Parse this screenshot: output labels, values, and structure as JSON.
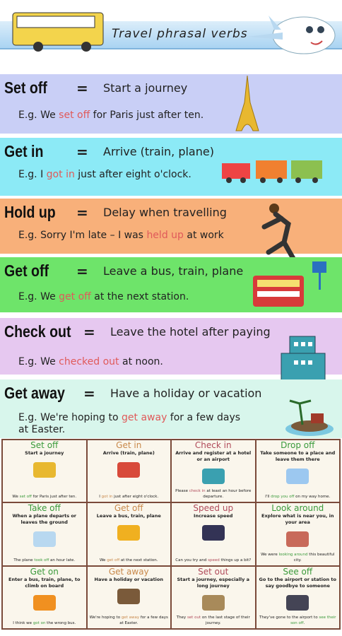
{
  "header": {
    "title": "Travel phrasal verbs"
  },
  "colors": {
    "highlight": "#e05a5a",
    "border": "#7a4a3a"
  },
  "bands": [
    {
      "verb": "Set off",
      "eq": "=",
      "def": "Start a journey",
      "ex": [
        "E.g. We ",
        "set off",
        " for Paris just after ten."
      ],
      "bg": "#c9cff6",
      "icon": "eiffel-tower-icon"
    },
    {
      "verb": "Get in",
      "eq": "=",
      "def": "Arrive (train, plane)",
      "ex": [
        "E.g. I ",
        "got in",
        " just after eight o'clock."
      ],
      "bg": "#8ceaf6",
      "icon": "train-icon"
    },
    {
      "verb": "Hold up",
      "eq": "=",
      "def": "Delay when travelling",
      "ex": [
        "E.g. Sorry I'm late – I was ",
        "held up",
        " at work"
      ],
      "bg": "#f8b07a",
      "icon": "running-man-icon"
    },
    {
      "verb": "Get off",
      "eq": "=",
      "def": "Leave a bus, train, plane",
      "ex": [
        "E.g. We ",
        "get off",
        " at the next station."
      ],
      "bg": "#6ee46a",
      "icon": "double-decker-bus-icon"
    },
    {
      "verb": "Check out",
      "eq": "=",
      "def": "Leave the hotel after paying",
      "ex": [
        "E.g. We ",
        "checked out",
        " at noon."
      ],
      "bg": "#e6c8f0",
      "icon": "hotel-icon"
    },
    {
      "verb": "Get away",
      "eq": "=",
      "def": "Have a holiday or vacation",
      "ex": [
        "E.g. We're hoping to ",
        "get away",
        " for a few days at Easter."
      ],
      "bg": "#d8f6ec",
      "icon": "island-icon"
    }
  ],
  "grid": [
    {
      "title": "Set off",
      "def": "Start a journey",
      "ex": [
        "We ",
        "set off",
        " for Paris just after ten."
      ],
      "color": "#3a9a3a"
    },
    {
      "title": "Get in",
      "def": "Arrive (train, plane)",
      "ex": [
        "I ",
        "got in",
        " just after eight o'clock."
      ],
      "color": "#c8884a"
    },
    {
      "title": "Check in",
      "def": "Arrive and register at a hotel or an airport",
      "ex": [
        "Please ",
        "check in",
        " at least an hour before departure."
      ],
      "color": "#b04a5a"
    },
    {
      "title": "Drop off",
      "def": "Take someone to a place and leave them there",
      "ex": [
        "I'll ",
        "drop you off",
        " on my way home."
      ],
      "color": "#3a9a3a"
    },
    {
      "title": "Take off",
      "def": "When a plane departs or leaves the ground",
      "ex": [
        "The plane ",
        "took off",
        " an hour late."
      ],
      "color": "#3a9a3a"
    },
    {
      "title": "Get off",
      "def": "Leave a bus, train, plane",
      "ex": [
        "We ",
        "get off",
        " at the next station."
      ],
      "color": "#c8884a"
    },
    {
      "title": "Speed up",
      "def": "Increase speed",
      "ex": [
        "Can you try and ",
        "speed",
        " things up a bit?"
      ],
      "color": "#b04a5a"
    },
    {
      "title": "Look around",
      "def": "Explore what is near you, in your area",
      "ex": [
        "We were ",
        "looking around",
        " this beautiful city."
      ],
      "color": "#3a9a3a"
    },
    {
      "title": "Get on",
      "def": "Enter a bus, train, plane, to climb on board",
      "ex": [
        "I think we ",
        "got on",
        " the wrong bus."
      ],
      "color": "#3a9a3a"
    },
    {
      "title": "Get away",
      "def": "Have a holiday or vacation",
      "ex": [
        "We're hoping to ",
        "get away",
        " for a few days at Easter."
      ],
      "color": "#c8884a"
    },
    {
      "title": "Set out",
      "def": "Start a journey, especially a long journey",
      "ex": [
        "They ",
        "set out",
        " on the last stage of their journey."
      ],
      "color": "#b04a5a"
    },
    {
      "title": "See off",
      "def": "Go to the airport or station to say goodbye to someone",
      "ex": [
        "They've gone to the airport to ",
        "see their son off",
        "."
      ],
      "color": "#3a9a3a"
    }
  ]
}
